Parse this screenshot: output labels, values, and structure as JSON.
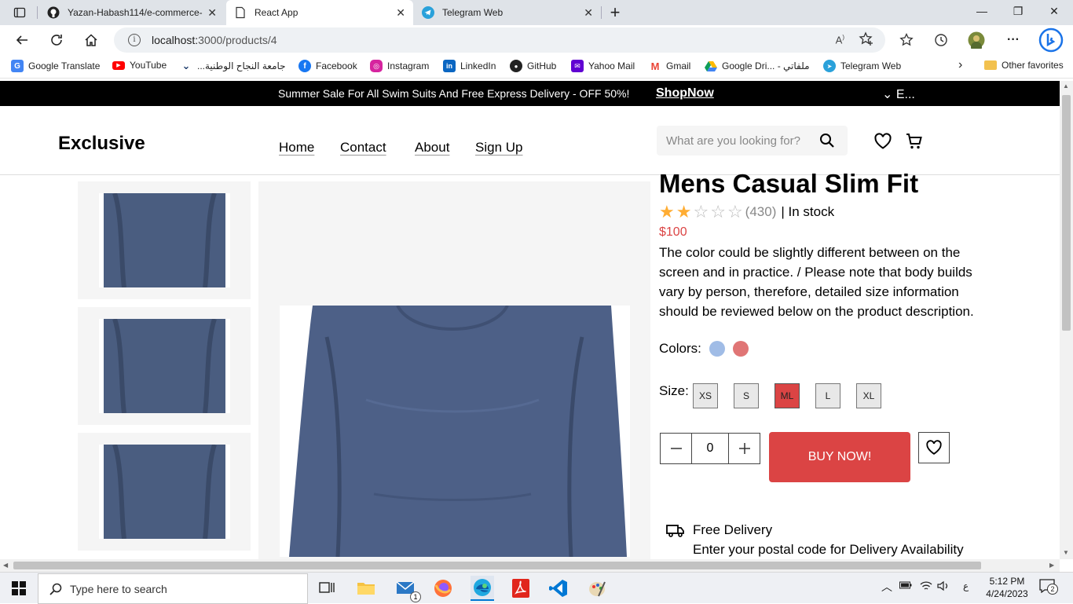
{
  "browser": {
    "tabs": [
      {
        "label": "Yazan-Habash114/e-commerce-a",
        "icon": "github-icon",
        "active": false
      },
      {
        "label": "React App",
        "icon": "page-icon",
        "active": true
      },
      {
        "label": "Telegram Web",
        "icon": "telegram-icon",
        "active": false
      }
    ],
    "url_host": "localhost:",
    "url_path": "3000/products/4",
    "bookmarks": [
      {
        "label": "Google Translate",
        "icon": "google-translate-icon",
        "color": "#4285f4"
      },
      {
        "label": "YouTube",
        "icon": "youtube-icon",
        "color": "#ff0000"
      },
      {
        "label": "جامعة النجاح الوطنية...",
        "icon": "najah-icon",
        "color": "#1b3a6b"
      },
      {
        "label": "Facebook",
        "icon": "facebook-icon",
        "color": "#1877f2"
      },
      {
        "label": "Instagram",
        "icon": "instagram-icon",
        "color": "#d6249f"
      },
      {
        "label": "LinkedIn",
        "icon": "linkedin-icon",
        "color": "#0a66c2"
      },
      {
        "label": "GitHub",
        "icon": "github-icon",
        "color": "#222222"
      },
      {
        "label": "Yahoo Mail",
        "icon": "yahoo-icon",
        "color": "#6001d2"
      },
      {
        "label": "Gmail",
        "icon": "gmail-icon",
        "color": "#ea4335"
      },
      {
        "label": "Google Dri... - ملفاتي",
        "icon": "google-drive-icon",
        "color": "#0f9d58"
      },
      {
        "label": "Telegram Web",
        "icon": "telegram-icon",
        "color": "#2aa1da"
      }
    ],
    "other_favorites": "Other favorites"
  },
  "promo": {
    "message": "Summer Sale For All Swim Suits And Free Express Delivery - OFF 50%!",
    "cta": "ShopNow",
    "language": "⌄  E..."
  },
  "header": {
    "logo": "Exclusive",
    "nav": [
      "Home",
      "Contact",
      "About",
      "Sign Up"
    ],
    "search_placeholder": "What are you looking for?"
  },
  "product": {
    "title": "Mens Casual Slim Fit",
    "rating": 2,
    "rating_max": 5,
    "reviews": "(430)",
    "stock": "| In stock",
    "price": "$100",
    "description": "The color could be slightly different between on the screen and in practice. / Please note that body builds vary by person, therefore, detailed size information should be reviewed below on the product description.",
    "colors_label": "Colors:",
    "colors": [
      "#a0bce6",
      "#e07575"
    ],
    "size_label": "Size:",
    "sizes": [
      "XS",
      "S",
      "ML",
      "L",
      "XL"
    ],
    "selected_size": "ML",
    "quantity": "0",
    "buy_label": "BUY NOW!",
    "delivery_title": "Free Delivery",
    "delivery_desc": "Enter your postal code for Delivery Availability"
  },
  "taskbar": {
    "search_placeholder": "Type here to search",
    "time": "5:12 PM",
    "date": "4/24/2023",
    "lang": "ع",
    "notifications": "2",
    "mail_badge": "1"
  },
  "colors": {
    "accent": "#db4444",
    "star": "#ffad33"
  }
}
